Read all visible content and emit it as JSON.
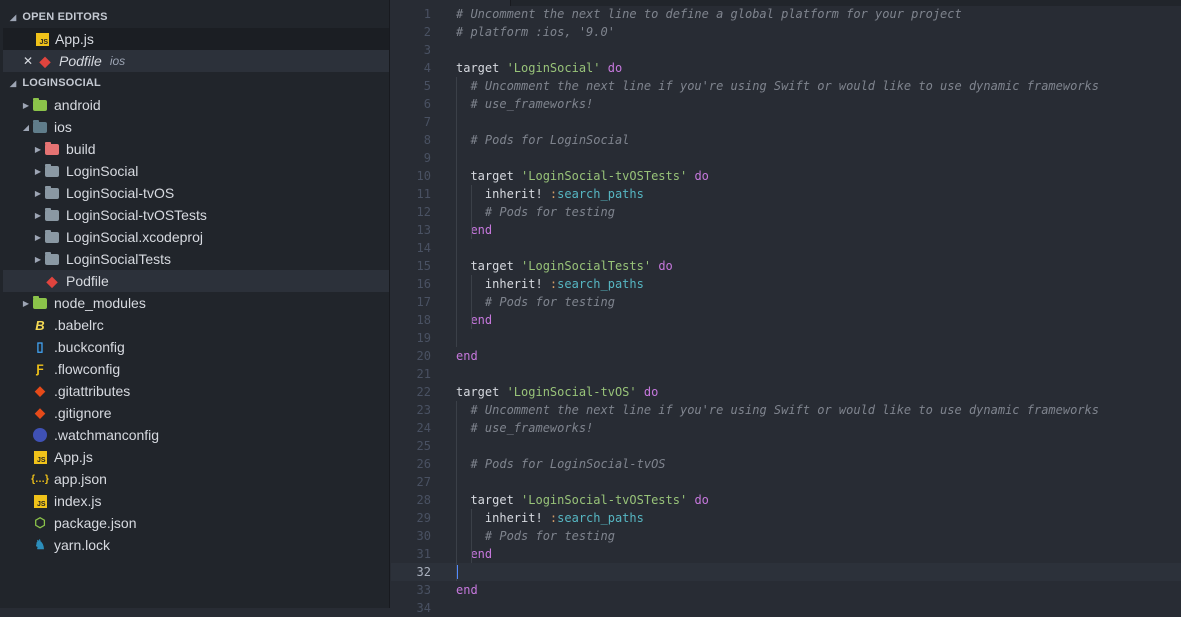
{
  "sidebar": {
    "open_editors_title": "OPEN EDITORS",
    "open_editors": [
      {
        "label": "App.js",
        "icon": "js-icon"
      },
      {
        "label": "Podfile",
        "hint": "ios",
        "icon": "ruby-gem-icon"
      }
    ],
    "project_title": "LOGINSOCIAL",
    "tree": [
      {
        "label": "android",
        "icon": "android-folder-icon",
        "depth": 0,
        "arrow": "right"
      },
      {
        "label": "ios",
        "icon": "ios-folder-icon",
        "depth": 0,
        "arrow": "down"
      },
      {
        "label": "build",
        "icon": "build-folder-icon",
        "depth": 1,
        "arrow": "right"
      },
      {
        "label": "LoginSocial",
        "icon": "folder-icon",
        "depth": 1,
        "arrow": "right"
      },
      {
        "label": "LoginSocial-tvOS",
        "icon": "folder-icon",
        "depth": 1,
        "arrow": "right"
      },
      {
        "label": "LoginSocial-tvOSTests",
        "icon": "folder-icon",
        "depth": 1,
        "arrow": "right"
      },
      {
        "label": "LoginSocial.xcodeproj",
        "icon": "folder-icon",
        "depth": 1,
        "arrow": "right"
      },
      {
        "label": "LoginSocialTests",
        "icon": "folder-icon",
        "depth": 1,
        "arrow": "right"
      },
      {
        "label": "Podfile",
        "icon": "ruby-gem-icon",
        "depth": 1,
        "selected": true
      },
      {
        "label": "node_modules",
        "icon": "node-folder-icon",
        "depth": 0,
        "arrow": "right"
      },
      {
        "label": ".babelrc",
        "icon": "babel-icon",
        "depth": 0
      },
      {
        "label": ".buckconfig",
        "icon": "file-icon",
        "depth": 0
      },
      {
        "label": ".flowconfig",
        "icon": "flow-icon",
        "depth": 0
      },
      {
        "label": ".gitattributes",
        "icon": "git-icon",
        "depth": 0
      },
      {
        "label": ".gitignore",
        "icon": "git-icon",
        "depth": 0
      },
      {
        "label": ".watchmanconfig",
        "icon": "watchman-icon",
        "depth": 0
      },
      {
        "label": "App.js",
        "icon": "js-icon",
        "depth": 0
      },
      {
        "label": "app.json",
        "icon": "json-icon",
        "depth": 0
      },
      {
        "label": "index.js",
        "icon": "js-icon",
        "depth": 0
      },
      {
        "label": "package.json",
        "icon": "nodejs-icon",
        "depth": 0
      },
      {
        "label": "yarn.lock",
        "icon": "yarn-icon",
        "depth": 0
      }
    ]
  },
  "editor": {
    "current_line": 32,
    "lines": [
      [
        [
          "c",
          "# Uncomment the next line to define a global platform for your project"
        ]
      ],
      [
        [
          "c",
          "# platform :ios, '9.0'"
        ]
      ],
      [],
      [
        [
          "t",
          "target "
        ],
        [
          "s",
          "'LoginSocial'"
        ],
        [
          "t",
          " "
        ],
        [
          "k",
          "do"
        ]
      ],
      [
        [
          "t",
          "  "
        ],
        [
          "c",
          "# Uncomment the next line if you're using Swift or would like to use dynamic frameworks"
        ]
      ],
      [
        [
          "t",
          "  "
        ],
        [
          "c",
          "# use_frameworks!"
        ]
      ],
      [],
      [
        [
          "t",
          "  "
        ],
        [
          "c",
          "# Pods for LoginSocial"
        ]
      ],
      [],
      [
        [
          "t",
          "  target "
        ],
        [
          "s",
          "'LoginSocial-tvOSTests'"
        ],
        [
          "t",
          " "
        ],
        [
          "k",
          "do"
        ]
      ],
      [
        [
          "t",
          "    inherit! "
        ],
        [
          "p",
          ":"
        ],
        [
          "sy",
          "search_paths"
        ]
      ],
      [
        [
          "t",
          "    "
        ],
        [
          "c",
          "# Pods for testing"
        ]
      ],
      [
        [
          "t",
          "  "
        ],
        [
          "k",
          "end"
        ]
      ],
      [],
      [
        [
          "t",
          "  target "
        ],
        [
          "s",
          "'LoginSocialTests'"
        ],
        [
          "t",
          " "
        ],
        [
          "k",
          "do"
        ]
      ],
      [
        [
          "t",
          "    inherit! "
        ],
        [
          "p",
          ":"
        ],
        [
          "sy",
          "search_paths"
        ]
      ],
      [
        [
          "t",
          "    "
        ],
        [
          "c",
          "# Pods for testing"
        ]
      ],
      [
        [
          "t",
          "  "
        ],
        [
          "k",
          "end"
        ]
      ],
      [],
      [
        [
          "k",
          "end"
        ]
      ],
      [],
      [
        [
          "t",
          "target "
        ],
        [
          "s",
          "'LoginSocial-tvOS'"
        ],
        [
          "t",
          " "
        ],
        [
          "k",
          "do"
        ]
      ],
      [
        [
          "t",
          "  "
        ],
        [
          "c",
          "# Uncomment the next line if you're using Swift or would like to use dynamic frameworks"
        ]
      ],
      [
        [
          "t",
          "  "
        ],
        [
          "c",
          "# use_frameworks!"
        ]
      ],
      [],
      [
        [
          "t",
          "  "
        ],
        [
          "c",
          "# Pods for LoginSocial-tvOS"
        ]
      ],
      [],
      [
        [
          "t",
          "  target "
        ],
        [
          "s",
          "'LoginSocial-tvOSTests'"
        ],
        [
          "t",
          " "
        ],
        [
          "k",
          "do"
        ]
      ],
      [
        [
          "t",
          "    inherit! "
        ],
        [
          "p",
          ":"
        ],
        [
          "sy",
          "search_paths"
        ]
      ],
      [
        [
          "t",
          "    "
        ],
        [
          "c",
          "# Pods for testing"
        ]
      ],
      [
        [
          "t",
          "  "
        ],
        [
          "k",
          "end"
        ]
      ],
      [],
      [
        [
          "k",
          "end"
        ]
      ],
      []
    ]
  }
}
